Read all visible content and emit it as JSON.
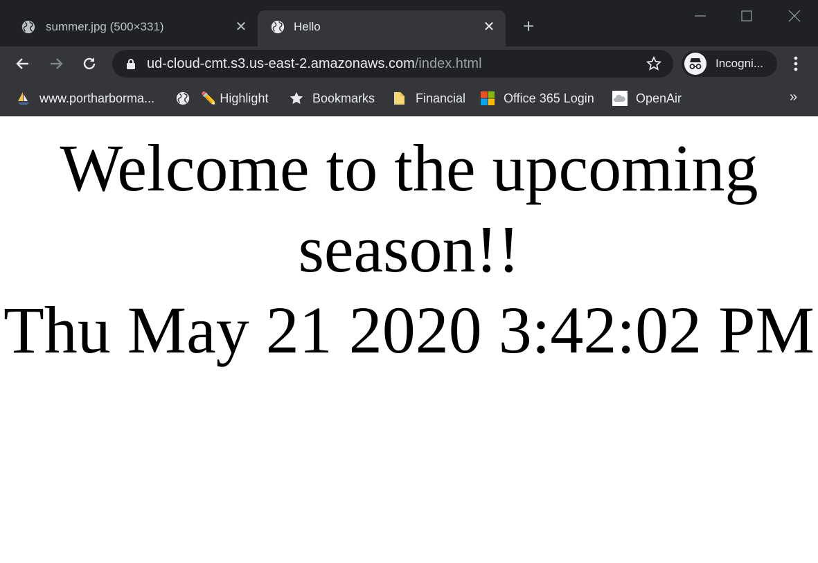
{
  "tabs": [
    {
      "title": "summer.jpg (500×331)",
      "icon": "globe-icon",
      "active": false
    },
    {
      "title": "Hello",
      "icon": "globe-icon",
      "active": true
    }
  ],
  "omnibox": {
    "host": "ud-cloud-cmt.s3.us-east-2.amazonaws.com",
    "path": "/index.html"
  },
  "profile": {
    "label": "Incogni..."
  },
  "bookmarks": [
    {
      "label": "www.portharborma...",
      "icon": "sailboat-icon"
    },
    {
      "label": "",
      "icon": "globe-icon"
    },
    {
      "label": "✏️ Highlight",
      "icon": ""
    },
    {
      "label": "Bookmarks",
      "icon": "star-icon"
    },
    {
      "label": "Financial",
      "icon": "folder-icon"
    },
    {
      "label": "Office 365 Login",
      "icon": "microsoft-icon"
    },
    {
      "label": "OpenAir",
      "icon": "cloud-icon"
    }
  ],
  "bookmarks_overflow": "»",
  "page": {
    "heading": "Welcome to the upcoming season!!",
    "datetime": "Thu May 21 2020 3:42:02 PM"
  },
  "colors": {
    "frame": "#202124",
    "toolbar": "#35363a",
    "text": "#e8eaed"
  }
}
